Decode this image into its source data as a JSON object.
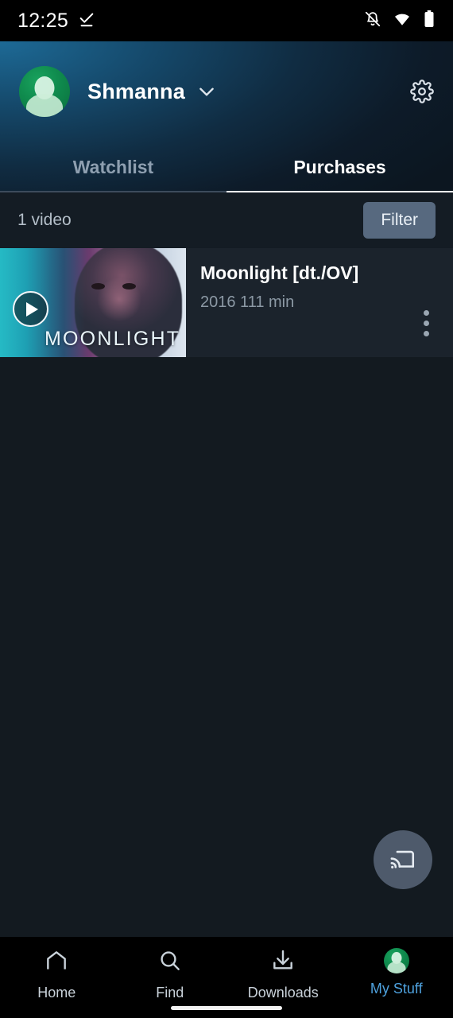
{
  "status_bar": {
    "time": "12:25",
    "icons": [
      "download-complete-icon",
      "notifications-off-icon",
      "wifi-icon",
      "battery-full-icon"
    ]
  },
  "header": {
    "profile_name": "Shmanna",
    "avatar_color": "#0f8a4d",
    "settings_icon": "gear-icon",
    "dropdown_icon": "chevron-down-icon",
    "tabs": [
      {
        "label": "Watchlist",
        "active": false
      },
      {
        "label": "Purchases",
        "active": true
      }
    ]
  },
  "list_header": {
    "count_label": "1 video",
    "filter_label": "Filter",
    "filter_bg": "#57697f"
  },
  "items": [
    {
      "title": "Moonlight [dt./OV]",
      "year": "2016",
      "duration": "111 min",
      "meta": "2016  111 min",
      "thumbnail_caption": "MOONLIGHT",
      "play_icon": "play-icon",
      "overflow_icon": "more-vertical-icon"
    }
  ],
  "cast_button": {
    "icon": "cast-icon",
    "bg": "#4e5a6b"
  },
  "bottom_nav": {
    "active_color": "#4ea1dd",
    "items": [
      {
        "label": "Home",
        "icon": "home-icon",
        "active": false
      },
      {
        "label": "Find",
        "icon": "search-icon",
        "active": false
      },
      {
        "label": "Downloads",
        "icon": "download-icon",
        "active": false
      },
      {
        "label": "My Stuff",
        "icon": "profile-avatar-icon",
        "active": true
      }
    ]
  }
}
